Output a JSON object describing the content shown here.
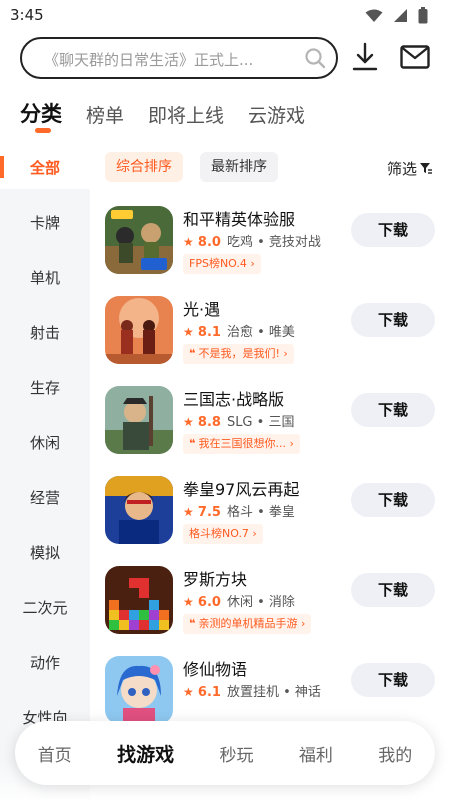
{
  "status": {
    "time": "3:45"
  },
  "search": {
    "placeholder": "《聊天群的日常生活》正式上..."
  },
  "tabs": [
    "分类",
    "榜单",
    "即将上线",
    "云游戏"
  ],
  "sidebar": [
    "全部",
    "卡牌",
    "单机",
    "射击",
    "生存",
    "休闲",
    "经营",
    "模拟",
    "二次元",
    "动作",
    "女性向"
  ],
  "sort": {
    "active": "综合排序",
    "other": "最新排序",
    "filter": "筛选"
  },
  "games": [
    {
      "name": "和平精英体验服",
      "score": "8.0",
      "genre": "吃鸡 • 竞技对战",
      "tag": "FPS榜NO.4",
      "quote": false,
      "download": "下载",
      "theme": "#3a6e2a"
    },
    {
      "name": "光·遇",
      "score": "8.1",
      "genre": "治愈 • 唯美",
      "tag": "不是我，是我们!",
      "quote": true,
      "download": "下载",
      "theme": "#e07a4a"
    },
    {
      "name": "三国志·战略版",
      "score": "8.8",
      "genre": "SLG • 三国",
      "tag": "我在三国很想你...",
      "quote": true,
      "download": "下载",
      "theme": "#6b8d5a"
    },
    {
      "name": "拳皇97风云再起",
      "score": "7.5",
      "genre": "格斗 • 拳皇",
      "tag": "格斗榜NO.7",
      "quote": false,
      "download": "下载",
      "theme": "#1d3f9a"
    },
    {
      "name": "罗斯方块",
      "score": "6.0",
      "genre": "休闲 • 消除",
      "tag": "亲测的单机精品手游",
      "quote": true,
      "download": "下载",
      "theme": "#5a2a1a"
    },
    {
      "name": "修仙物语",
      "score": "6.1",
      "genre": "放置挂机 • 神话",
      "tag": "",
      "quote": false,
      "download": "下载",
      "theme": "#5a9fe0"
    }
  ],
  "nav": [
    "首页",
    "找游戏",
    "秒玩",
    "福利",
    "我的"
  ]
}
